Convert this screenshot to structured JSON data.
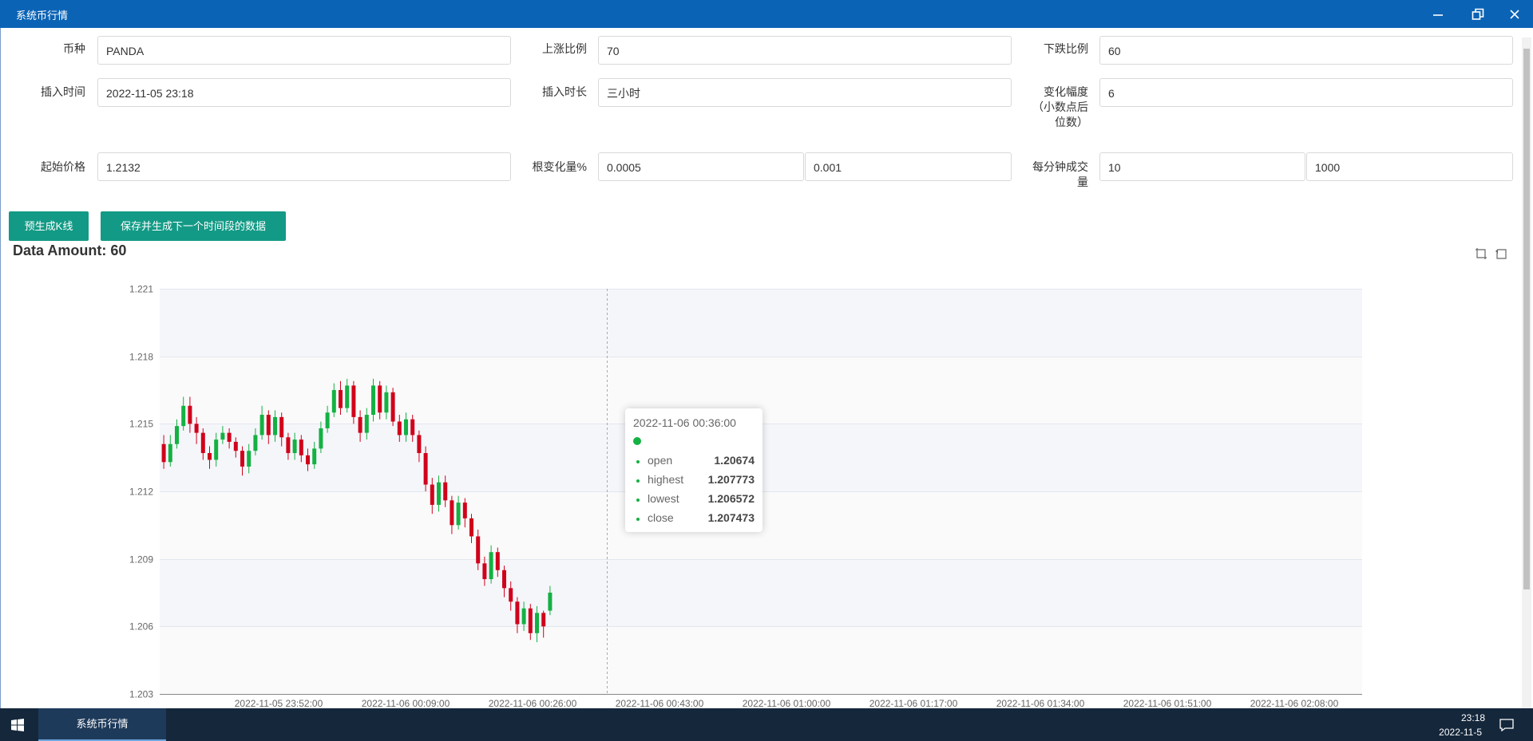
{
  "window": {
    "title": "系统币行情"
  },
  "form": {
    "coin_label": "币种",
    "coin_value": "PANDA",
    "rise_label": "上涨比例",
    "rise_value": "70",
    "fall_label": "下跌比例",
    "fall_value": "60",
    "insert_time_label": "插入时间",
    "insert_time_value": "2022-11-05 23:18",
    "insert_duration_label": "插入时长",
    "insert_duration_value": "三小时",
    "change_range_label": "变化幅度\n（小数点后\n位数）",
    "change_range_value": "6",
    "start_price_label": "起始价格",
    "start_price_value": "1.2132",
    "root_change_label": "根变化量%",
    "root_change_min": "0.0005",
    "root_change_max": "0.001",
    "volume_label": "每分钟成交\n量",
    "volume_min": "10",
    "volume_max": "1000"
  },
  "buttons": {
    "pregen": "预生成K线",
    "save_next": "保存并生成下一个时间段的数据"
  },
  "chart_header": {
    "amount": "Data Amount: 60"
  },
  "tooltip": {
    "time": "2022-11-06 00:36:00",
    "rows": [
      {
        "name": "open",
        "value": "1.20674"
      },
      {
        "name": "highest",
        "value": "1.207773"
      },
      {
        "name": "lowest",
        "value": "1.206572"
      },
      {
        "name": "close",
        "value": "1.207473"
      }
    ]
  },
  "taskbar": {
    "app": "系统币行情",
    "time": "23:18",
    "date": "2022-11-5"
  },
  "colors": {
    "up": "#14b143",
    "down": "#d0021b",
    "accent": "#139a86",
    "titlebar": "#0b63b5",
    "taskbar": "#15273b"
  },
  "chart_data": {
    "type": "candlestick",
    "ylim": [
      1.203,
      1.221
    ],
    "yticks": [
      "1.203",
      "1.206",
      "1.209",
      "1.212",
      "1.215",
      "1.218",
      "1.221"
    ],
    "xticks": [
      "2022-11-05 23:52:00",
      "2022-11-06 00:09:00",
      "2022-11-06 00:26:00",
      "2022-11-06 00:43:00",
      "2022-11-06 01:00:00",
      "2022-11-06 01:17:00",
      "2022-11-06 01:34:00",
      "2022-11-06 01:51:00",
      "2022-11-06 02:08:00"
    ],
    "grid": true,
    "candles": [
      [
        1.2141,
        1.2133,
        1.2145,
        1.213
      ],
      [
        1.2133,
        1.2141,
        1.2145,
        1.2131
      ],
      [
        1.2141,
        1.2149,
        1.2152,
        1.2139
      ],
      [
        1.2149,
        1.2158,
        1.2162,
        1.2147
      ],
      [
        1.2158,
        1.215,
        1.2162,
        1.2146
      ],
      [
        1.215,
        1.2146,
        1.2153,
        1.2141
      ],
      [
        1.2146,
        1.2137,
        1.2148,
        1.2134
      ],
      [
        1.2137,
        1.2134,
        1.214,
        1.213
      ],
      [
        1.2134,
        1.2143,
        1.2146,
        1.2131
      ],
      [
        1.2143,
        1.2146,
        1.2149,
        1.2141
      ],
      [
        1.2146,
        1.2142,
        1.2148,
        1.2139
      ],
      [
        1.2142,
        1.2138,
        1.2144,
        1.2135
      ],
      [
        1.2138,
        1.2131,
        1.214,
        1.2127
      ],
      [
        1.2131,
        1.2138,
        1.2141,
        1.2128
      ],
      [
        1.2138,
        1.2145,
        1.2148,
        1.2136
      ],
      [
        1.2145,
        1.2154,
        1.2158,
        1.2143
      ],
      [
        1.2154,
        1.2145,
        1.2156,
        1.2141
      ],
      [
        1.2145,
        1.2153,
        1.2156,
        1.2142
      ],
      [
        1.2153,
        1.2144,
        1.2155,
        1.214
      ],
      [
        1.2144,
        1.2137,
        1.2146,
        1.2134
      ],
      [
        1.2137,
        1.2143,
        1.2146,
        1.2134
      ],
      [
        1.2143,
        1.2136,
        1.2145,
        1.2133
      ],
      [
        1.2136,
        1.2132,
        1.2139,
        1.2129
      ],
      [
        1.2132,
        1.2139,
        1.2142,
        1.213
      ],
      [
        1.2139,
        1.2148,
        1.2151,
        1.2137
      ],
      [
        1.2148,
        1.2155,
        1.2158,
        1.2146
      ],
      [
        1.2155,
        1.2165,
        1.2168,
        1.2153
      ],
      [
        1.2165,
        1.2157,
        1.2169,
        1.2154
      ],
      [
        1.2157,
        1.2167,
        1.217,
        1.2155
      ],
      [
        1.2167,
        1.2153,
        1.2169,
        1.215
      ],
      [
        1.2153,
        1.2146,
        1.2156,
        1.2142
      ],
      [
        1.2146,
        1.2154,
        1.2157,
        1.2143
      ],
      [
        1.2154,
        1.2167,
        1.217,
        1.2151
      ],
      [
        1.2167,
        1.2155,
        1.2169,
        1.2152
      ],
      [
        1.2155,
        1.2164,
        1.2167,
        1.2152
      ],
      [
        1.2164,
        1.2151,
        1.2166,
        1.2149
      ],
      [
        1.2151,
        1.2145,
        1.2154,
        1.2142
      ],
      [
        1.2145,
        1.2152,
        1.2155,
        1.2142
      ],
      [
        1.2152,
        1.2145,
        1.2154,
        1.2142
      ],
      [
        1.2145,
        1.2137,
        1.2147,
        1.2133
      ],
      [
        1.2137,
        1.2123,
        1.214,
        1.212
      ],
      [
        1.2123,
        1.2114,
        1.2126,
        1.211
      ],
      [
        1.2114,
        1.2124,
        1.2127,
        1.2111
      ],
      [
        1.2124,
        1.2116,
        1.2127,
        1.2113
      ],
      [
        1.2116,
        1.2105,
        1.2118,
        1.2101
      ],
      [
        1.2105,
        1.2115,
        1.2118,
        1.2103
      ],
      [
        1.2115,
        1.2108,
        1.2117,
        1.2104
      ],
      [
        1.2108,
        1.21,
        1.211,
        1.2097
      ],
      [
        1.21,
        1.2088,
        1.2103,
        1.2085
      ],
      [
        1.2088,
        1.2081,
        1.2091,
        1.2078
      ],
      [
        1.2081,
        1.2093,
        1.2096,
        1.2079
      ],
      [
        1.2093,
        1.2085,
        1.2095,
        1.2082
      ],
      [
        1.2085,
        1.2077,
        1.2087,
        1.2073
      ],
      [
        1.2077,
        1.2071,
        1.208,
        1.2067
      ],
      [
        1.2071,
        1.2061,
        1.2073,
        1.2057
      ],
      [
        1.2061,
        1.2068,
        1.2071,
        1.2058
      ],
      [
        1.2068,
        1.2057,
        1.207,
        1.2054
      ],
      [
        1.2057,
        1.2066,
        1.2069,
        1.2053
      ],
      [
        1.2066,
        1.206,
        1.2067,
        1.2055
      ],
      [
        1.2067,
        1.2075,
        1.2078,
        1.2065
      ]
    ]
  }
}
